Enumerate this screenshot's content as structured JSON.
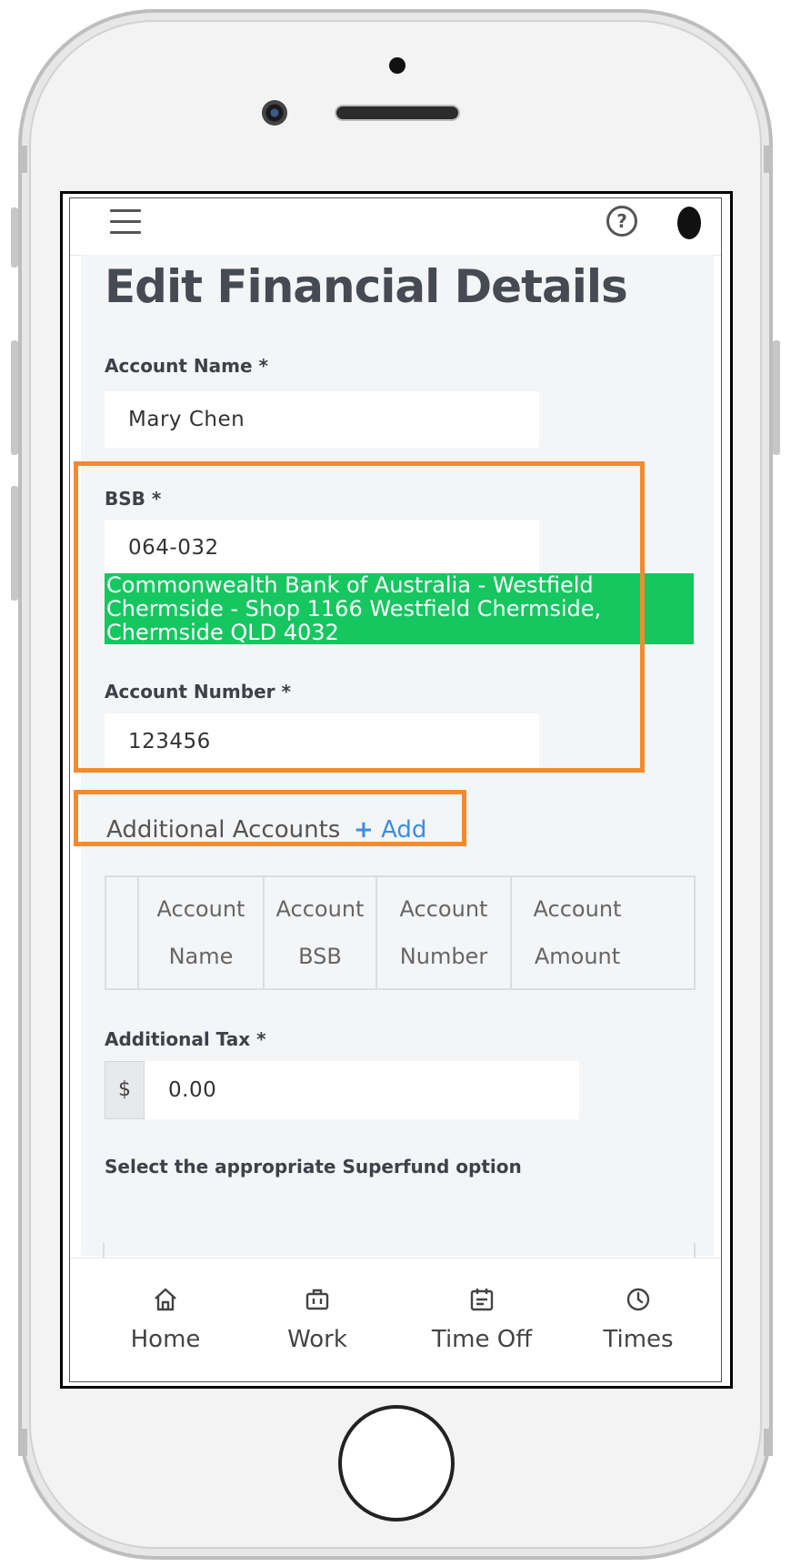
{
  "header": {
    "help_icon": "question-circle-icon",
    "menu_icon": "hamburger-icon"
  },
  "page": {
    "title": "Edit Financial Details"
  },
  "form": {
    "account_name": {
      "label": "Account Name *",
      "value": "Mary Chen"
    },
    "bsb": {
      "label": "BSB *",
      "value": "064-032",
      "bank_info": "Commonwealth Bank of Australia - Westfield Chermside - Shop 1166 Westfield Chermside, Chermside QLD 4032"
    },
    "account_number": {
      "label": "Account Number *",
      "value": "123456"
    },
    "additional_accounts": {
      "label": "Additional Accounts",
      "add_label": "Add"
    },
    "table_headers": [
      {
        "line1": "Account",
        "line2": "Name"
      },
      {
        "line1": "Account",
        "line2": "BSB"
      },
      {
        "line1": "Account",
        "line2": "Number"
      },
      {
        "line1": "Account",
        "line2": "Amount"
      }
    ],
    "additional_tax": {
      "label": "Additional Tax *",
      "prefix": "$",
      "value": "0.00"
    },
    "superfund": {
      "label": "Select the appropriate Superfund option"
    }
  },
  "tabs": [
    {
      "label": "Home",
      "icon": "home-icon"
    },
    {
      "label": "Work",
      "icon": "briefcase-icon"
    },
    {
      "label": "Time Off",
      "icon": "calendar-icon"
    },
    {
      "label": "Times",
      "icon": "clock-icon"
    }
  ],
  "colors": {
    "highlight": "#f28b30",
    "bank_banner": "#16c65f",
    "link": "#3a8ee6"
  }
}
